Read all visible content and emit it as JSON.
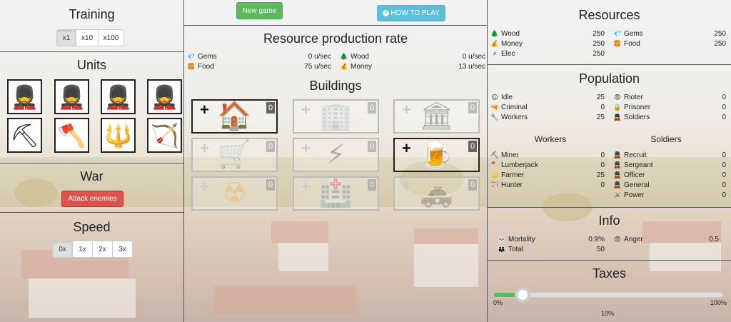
{
  "training": {
    "title": "Training",
    "multipliers": [
      "x1",
      "x10",
      "x100"
    ],
    "active_index": 0
  },
  "units": {
    "title": "Units",
    "items": [
      {
        "name": "guard",
        "icon": "💂"
      },
      {
        "name": "sergeant",
        "icon": "💂"
      },
      {
        "name": "officer",
        "icon": "💂"
      },
      {
        "name": "general",
        "icon": "💂"
      },
      {
        "name": "pickaxe",
        "icon": "⛏"
      },
      {
        "name": "axe",
        "icon": "🪓"
      },
      {
        "name": "pitchfork",
        "icon": "🔱"
      },
      {
        "name": "bow",
        "icon": "🏹"
      }
    ]
  },
  "war": {
    "title": "War",
    "attack_label": "Attack enemies"
  },
  "speed": {
    "title": "Speed",
    "options": [
      "0x",
      "1x",
      "2x",
      "3x"
    ],
    "active_index": 0
  },
  "top_buttons": {
    "new_game": "New game",
    "how_to_play": "HOW TO PLAY"
  },
  "production": {
    "title": "Resource production rate",
    "rows": [
      {
        "label": "Gems",
        "value": "0 u/sec",
        "icon": "gem-icon"
      },
      {
        "label": "Wood",
        "value": "0 u/sec",
        "icon": "tree-icon"
      },
      {
        "label": "Food",
        "value": "75 u/sec",
        "icon": "burger-icon"
      },
      {
        "label": "Money",
        "value": "13 u/sec",
        "icon": "moneybag-icon"
      }
    ]
  },
  "buildings": {
    "title": "Buildings",
    "items": [
      {
        "name": "house",
        "icon": "🏠",
        "count": "0",
        "enabled": true
      },
      {
        "name": "office",
        "icon": "🏢",
        "count": "0",
        "enabled": false
      },
      {
        "name": "bank",
        "icon": "🏛",
        "count": "0",
        "enabled": false
      },
      {
        "name": "market",
        "icon": "🛒",
        "count": "0",
        "enabled": false
      },
      {
        "name": "power",
        "icon": "⚡",
        "count": "0",
        "enabled": false
      },
      {
        "name": "tavern",
        "icon": "🍺",
        "count": "0",
        "enabled": true
      },
      {
        "name": "nuclear",
        "icon": "☢",
        "count": "0",
        "enabled": false
      },
      {
        "name": "hospital",
        "icon": "🏥",
        "count": "0",
        "enabled": false
      },
      {
        "name": "police",
        "icon": "🚓",
        "count": "0",
        "enabled": false
      }
    ]
  },
  "resources": {
    "title": "Resources",
    "left": [
      {
        "label": "Wood",
        "value": "250",
        "icon": "🌲"
      },
      {
        "label": "Money",
        "value": "250",
        "icon": "💰"
      },
      {
        "label": "Elec",
        "value": "250",
        "icon": "⚡"
      }
    ],
    "right": [
      {
        "label": "Gems",
        "value": "250",
        "icon": "💎"
      },
      {
        "label": "Food",
        "value": "250",
        "icon": "🍔"
      }
    ]
  },
  "population": {
    "title": "Population",
    "left": [
      {
        "label": "Idle",
        "value": "25",
        "icon": "😐"
      },
      {
        "label": "Criminal",
        "value": "0",
        "icon": "🔫"
      },
      {
        "label": "Workers",
        "value": "25",
        "icon": "🔧"
      }
    ],
    "right": [
      {
        "label": "Rioter",
        "value": "0",
        "icon": "😡"
      },
      {
        "label": "Prisoner",
        "value": "0",
        "icon": "🔒"
      },
      {
        "label": "Soldiers",
        "value": "0",
        "icon": "💂"
      }
    ]
  },
  "workers": {
    "title": "Workers",
    "rows": [
      {
        "label": "Miner",
        "value": "0",
        "icon": "⛏"
      },
      {
        "label": "Lumberjack",
        "value": "0",
        "icon": "🪓"
      },
      {
        "label": "Farmer",
        "value": "25",
        "icon": "🔱"
      },
      {
        "label": "Hunter",
        "value": "0",
        "icon": "🏹"
      }
    ]
  },
  "soldiers": {
    "title": "Soldiers",
    "rows": [
      {
        "label": "Recruit",
        "value": "0",
        "icon": "💂"
      },
      {
        "label": "Sergeant",
        "value": "0",
        "icon": "💂"
      },
      {
        "label": "Officer",
        "value": "0",
        "icon": "💂"
      },
      {
        "label": "General",
        "value": "0",
        "icon": "💂"
      },
      {
        "label": "Power",
        "value": "0",
        "icon": "⚔"
      }
    ]
  },
  "info": {
    "title": "Info",
    "mortality_label": "Mortality",
    "mortality_value": "0.9%",
    "anger_label": "Anger",
    "anger_value": "0.5",
    "total_label": "Total",
    "total_value": "50"
  },
  "taxes": {
    "title": "Taxes",
    "min_label": "0%",
    "max_label": "100%",
    "current_label": "10%",
    "value_fraction": 0.1
  },
  "colors": {
    "green": "#5cb85c",
    "red": "#d9534f",
    "blue": "#5bc0de"
  }
}
